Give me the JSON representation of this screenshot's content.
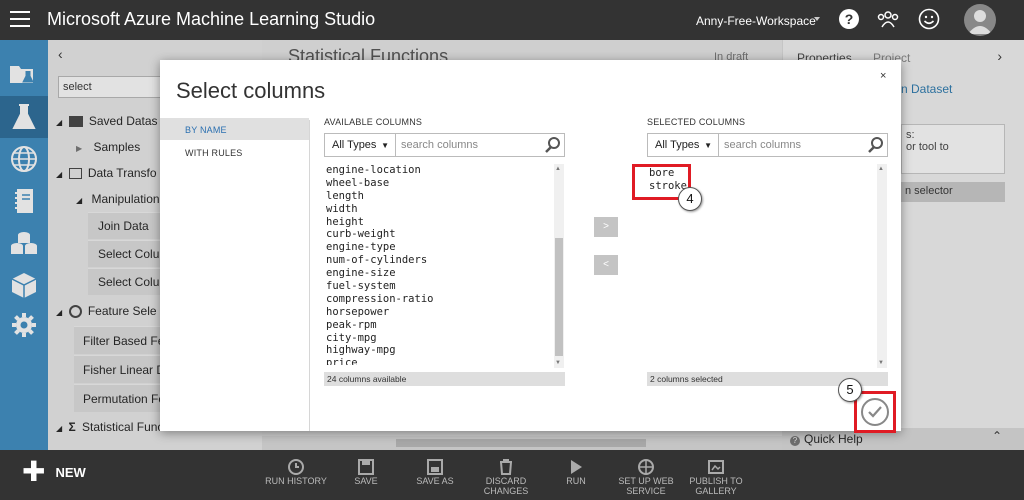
{
  "app": {
    "title": "Microsoft Azure Machine Learning Studio",
    "workspace": "Anny-Free-Workspace"
  },
  "palette": {
    "search_value": "select",
    "items": [
      {
        "label": "Saved Datas",
        "level": 0
      },
      {
        "label": "Samples",
        "level": 1
      },
      {
        "label": "Data Transfo",
        "level": 0
      },
      {
        "label": "Manipulation",
        "level": 1
      },
      {
        "label": "Join Data",
        "level": 2
      },
      {
        "label": "Select Colu",
        "level": 2
      },
      {
        "label": "Select Colu",
        "level": 2
      },
      {
        "label": "Feature Sele",
        "level": 0
      },
      {
        "label": "Filter Based Fea",
        "level": 2
      },
      {
        "label": "Fisher Linear Di",
        "level": 2
      },
      {
        "label": "Permutation Fe",
        "level": 2
      },
      {
        "label": "Statistical Functions",
        "level": 0
      }
    ]
  },
  "canvas": {
    "title": "Statistical Functions",
    "status": "In draft"
  },
  "properties": {
    "tab_properties": "Properties",
    "tab_project": "Project",
    "link": "n Dataset",
    "box_text": "s:\nor tool to",
    "selector_button": "n selector"
  },
  "quick_help": "Quick Help",
  "toolbar": {
    "new_label": "NEW",
    "buttons": [
      {
        "label": "RUN HISTORY",
        "icon": "clock-icon"
      },
      {
        "label": "SAVE",
        "icon": "save-icon"
      },
      {
        "label": "SAVE AS",
        "icon": "save-as-icon"
      },
      {
        "label": "DISCARD CHANGES",
        "icon": "trash-icon"
      },
      {
        "label": "RUN",
        "icon": "play-icon"
      },
      {
        "label": "SET UP WEB SERVICE",
        "icon": "globe-icon"
      },
      {
        "label": "PUBLISH TO GALLERY",
        "icon": "gallery-icon"
      }
    ]
  },
  "dialog": {
    "title": "Select columns",
    "close": "×",
    "tabs": [
      "BY NAME",
      "WITH RULES"
    ],
    "available": {
      "header": "AVAILABLE COLUMNS",
      "type_filter": "All Types",
      "search_placeholder": "search columns",
      "items": [
        "engine-location",
        "wheel-base",
        "length",
        "width",
        "height",
        "curb-weight",
        "engine-type",
        "num-of-cylinders",
        "engine-size",
        "fuel-system",
        "compression-ratio",
        "horsepower",
        "peak-rpm",
        "city-mpg",
        "highway-mpg",
        "price"
      ],
      "footer": "24 columns available"
    },
    "selected": {
      "header": "SELECTED COLUMNS",
      "type_filter": "All Types",
      "search_placeholder": "search columns",
      "items": [
        "bore",
        "stroke"
      ],
      "footer": "2 columns selected"
    },
    "move_right": ">",
    "move_left": "<",
    "annotations": [
      "4",
      "5"
    ],
    "callout_color": "#e01b24"
  }
}
